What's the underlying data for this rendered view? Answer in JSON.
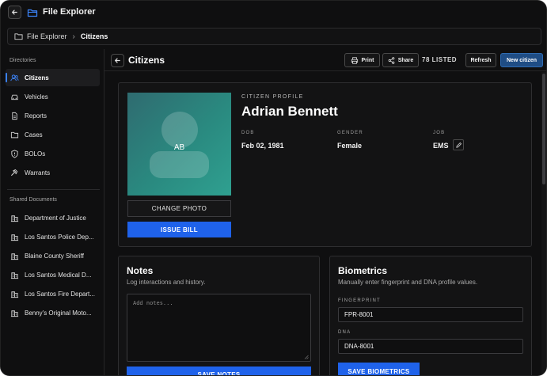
{
  "app": {
    "title": "File Explorer"
  },
  "breadcrumb": {
    "root": "File Explorer",
    "current": "Citizens"
  },
  "sidebar": {
    "directories_heading": "Directories",
    "directories": [
      {
        "label": "Citizens",
        "icon": "users-icon",
        "active": true
      },
      {
        "label": "Vehicles",
        "icon": "car-icon"
      },
      {
        "label": "Reports",
        "icon": "document-icon"
      },
      {
        "label": "Cases",
        "icon": "folder-icon"
      },
      {
        "label": "BOLOs",
        "icon": "alert-shield-icon"
      },
      {
        "label": "Warrants",
        "icon": "gavel-icon"
      }
    ],
    "shared_heading": "Shared Documents",
    "shared": [
      {
        "label": "Department of Justice",
        "icon": "building-icon"
      },
      {
        "label": "Los Santos Police Dep...",
        "icon": "building-icon"
      },
      {
        "label": "Blaine County Sheriff",
        "icon": "building-icon"
      },
      {
        "label": "Los Santos Medical D...",
        "icon": "building-icon"
      },
      {
        "label": "Los Santos Fire Depart...",
        "icon": "building-icon"
      },
      {
        "label": "Benny's Original Moto...",
        "icon": "building-icon"
      }
    ]
  },
  "header": {
    "title": "Citizens",
    "print_label": "Print",
    "share_label": "Share",
    "listed": "78 LISTED",
    "refresh_label": "Refresh",
    "new_label": "New citizen"
  },
  "profile": {
    "kicker": "CITIZEN PROFILE",
    "name": "Adrian Bennett",
    "initials": "AB",
    "change_photo_label": "CHANGE PHOTO",
    "issue_bill_label": "ISSUE BILL",
    "dob_label": "DOB",
    "dob": "Feb 02, 1981",
    "gender_label": "GENDER",
    "gender": "Female",
    "job_label": "JOB",
    "job": "EMS"
  },
  "notes": {
    "title": "Notes",
    "subtitle": "Log interactions and history.",
    "placeholder": "Add notes...",
    "save_label": "SAVE NOTES"
  },
  "biometrics": {
    "title": "Biometrics",
    "subtitle": "Manually enter fingerprint and DNA profile values.",
    "fingerprint_label": "FINGERPRINT",
    "fingerprint": "FPR-8001",
    "dna_label": "DNA",
    "dna": "DNA-8001",
    "save_label": "SAVE BIOMETRICS"
  },
  "colors": {
    "accent": "#1f62ea",
    "active_marker": "#3b82f6",
    "photo": "#2a8a80"
  }
}
